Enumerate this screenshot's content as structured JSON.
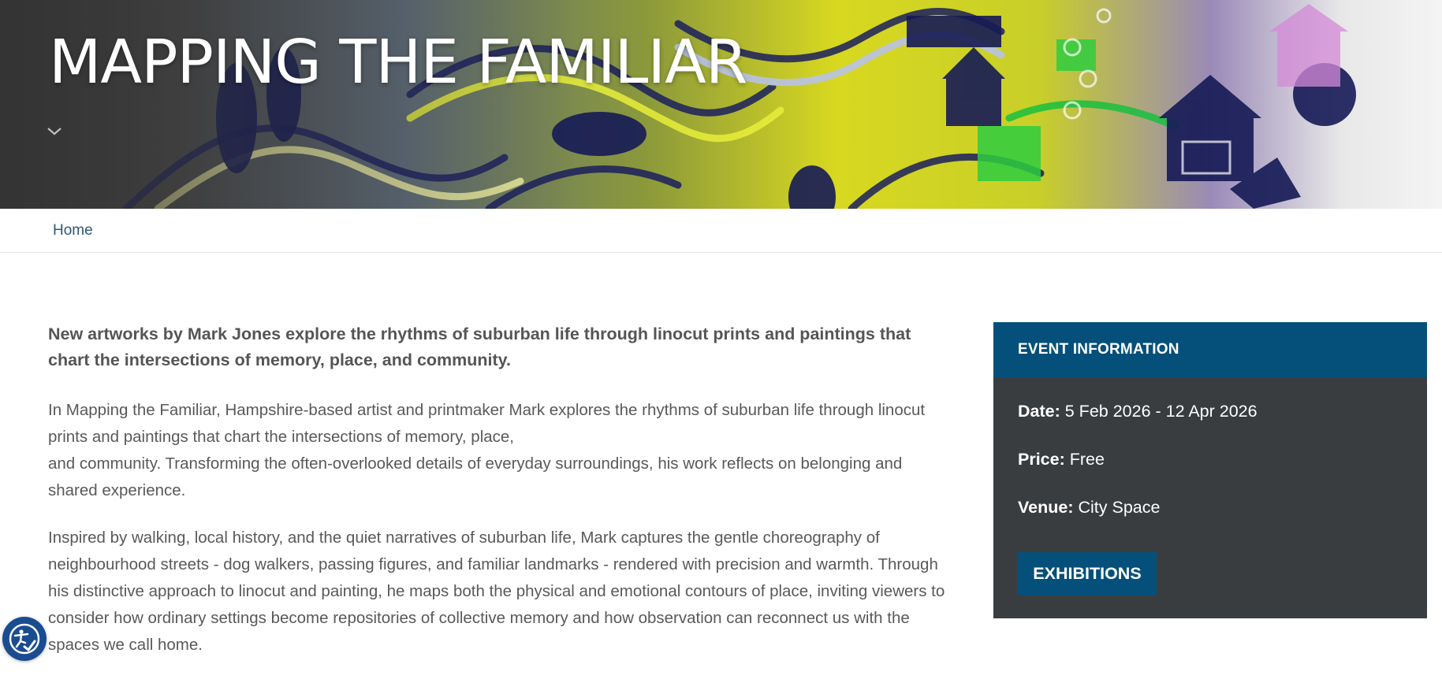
{
  "hero": {
    "title": "MAPPING THE FAMILIAR",
    "chevron_icon": "chevron-down-icon"
  },
  "breadcrumb": {
    "home_label": "Home"
  },
  "main": {
    "lead": "New artworks by Mark Jones explore the rhythms of suburban life through linocut prints and paintings that chart the intersections of memory, place, and community.",
    "paragraph_1_line_1": "In Mapping the Familiar, Hampshire-based artist and printmaker Mark explores the rhythms of suburban life through linocut prints and paintings that chart the intersections of memory, place,",
    "paragraph_1_line_2": "and community. Transforming the often-overlooked details of everyday surroundings, his work reflects on belonging and shared experience.",
    "paragraph_2": "Inspired by walking, local history, and the quiet narratives of suburban life, Mark captures the gentle choreography of neighbourhood streets - dog walkers, passing figures, and familiar landmarks - rendered with precision and warmth. Through his distinctive approach to linocut and painting, he maps both the physical and emotional contours of place, inviting viewers to consider how ordinary settings become repositories of collective memory and how observation can reconnect us with the spaces we call home."
  },
  "event": {
    "heading": "EVENT INFORMATION",
    "date_label": "Date:",
    "date_value": "5 Feb 2026 - 12 Apr 2026",
    "price_label": "Price:",
    "price_value": "Free",
    "venue_label": "Venue:",
    "venue_value": "City Space",
    "button_label": "EXHIBITIONS"
  },
  "accessibility": {
    "icon": "accessibility-icon"
  },
  "colors": {
    "brand_blue": "#05507a",
    "panel_dark": "#3a3d40",
    "link": "#2d5878"
  }
}
